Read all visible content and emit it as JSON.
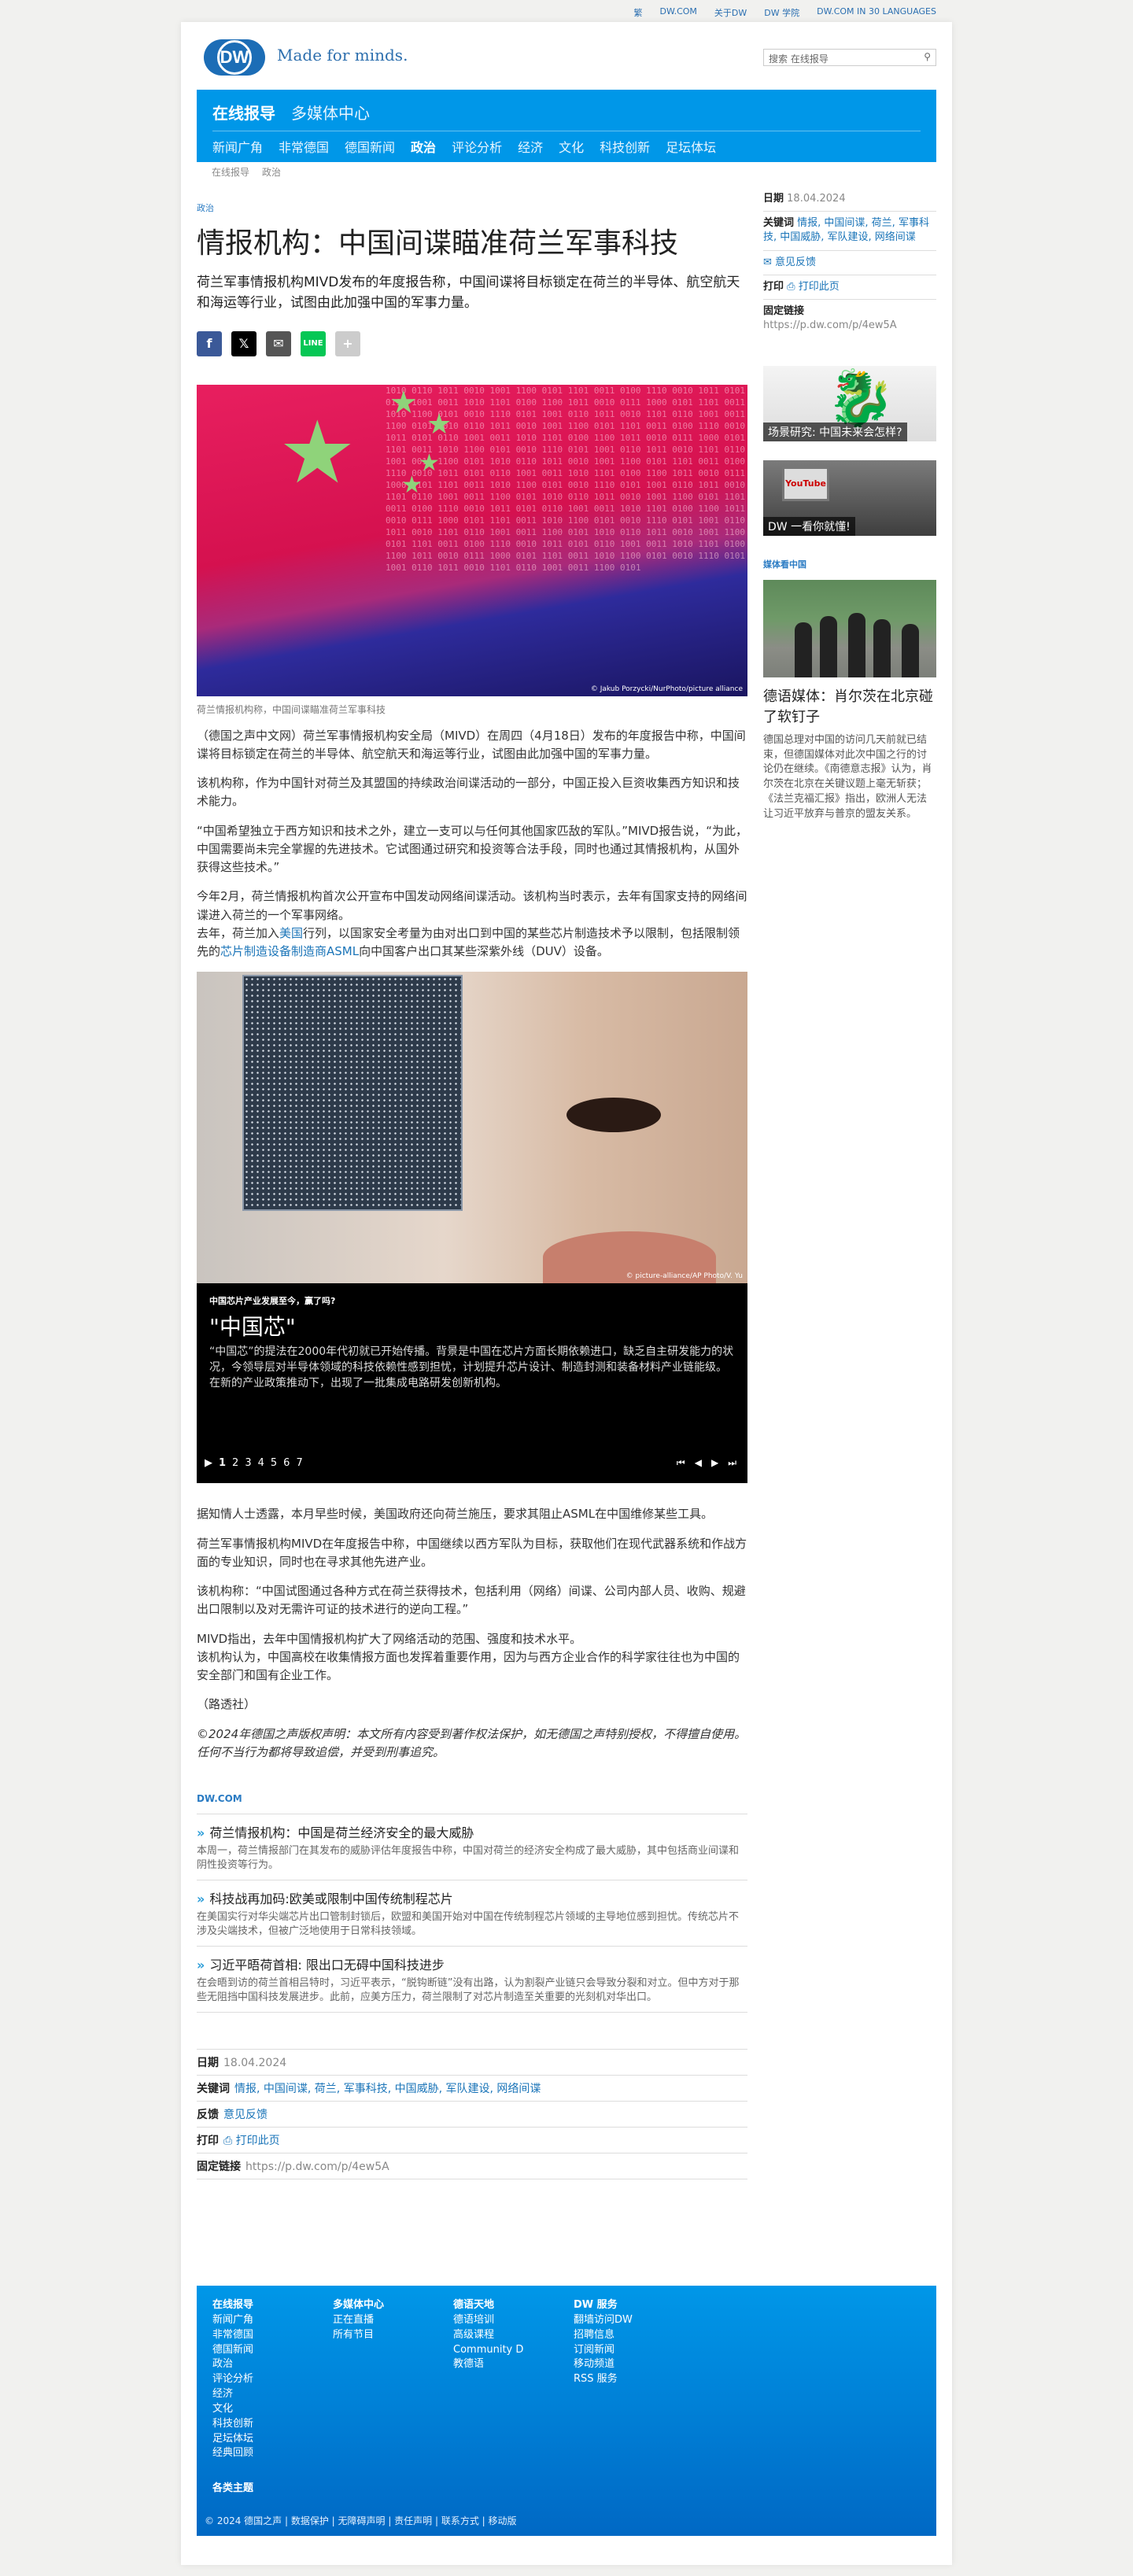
{
  "toplinks": [
    "繁",
    "DW.COM",
    "关于DW",
    "DW 学院",
    "DW.COM IN 30 LANGUAGES"
  ],
  "header": {
    "logo": "DW",
    "tagline": "Made for minds.",
    "search_placeholder": "搜索 在线报导"
  },
  "nav": {
    "tabs": [
      "在线报导",
      "多媒体中心"
    ],
    "sub": [
      "新闻广角",
      "非常德国",
      "德国新闻",
      "政治",
      "评论分析",
      "经济",
      "文化",
      "科技创新",
      "足坛体坛"
    ]
  },
  "breadcrumb": [
    "在线报导",
    "政治"
  ],
  "article": {
    "kicker": "政治",
    "title": "情报机构：中国间谍瞄准荷兰军事科技",
    "lead": "荷兰军事情报机构MIVD发布的年度报告称，中国间谍将目标锁定在荷兰的半导体、航空航天和海运等行业，试图由此加强中国的军事力量。",
    "image_credit": "© Jakub Porzycki/NurPhoto/picture alliance",
    "image_caption": "荷兰情报机构称，中国间谍瞄准荷兰军事科技",
    "p1": "（德国之声中文网）荷兰军事情报机构安全局（MIVD）在周四（4月18日）发布的年度报告中称，中国间谍将目标锁定在荷兰的半导体、航空航天和海运等行业，试图由此加强中国的军事力量。",
    "p2": "该机构称，作为中国针对荷兰及其盟国的持续政治间谍活动的一部分，中国正投入巨资收集西方知识和技术能力。",
    "p3": "“中国希望独立于西方知识和技术之外，建立一支可以与任何其他国家匹敌的军队。”MIVD报告说，“为此，中国需要尚未完全掌握的先进技术。它试图通过研究和投资等合法手段，同时也通过其情报机构，从国外获得这些技术。”",
    "p4": "今年2月，荷兰情报机构首次公开宣布中国发动网络间谍活动。该机构当时表示，去年有国家支持的网络间谍进入荷兰的一个军事网络。",
    "p5a": "去年，荷兰加入",
    "p5link1": "美国",
    "p5b": "行列，以国家安全考量为由对出口到中国的某些芯片制造技术予以限制，包括限制领先的",
    "p5link2": "芯片制造设备制造商ASML",
    "p5c": "向中国客户出口其某些深紫外线（DUV）设备。",
    "gallery_credit": "© picture-alliance/AP Photo/V. Yu",
    "gallery_kicker": "中国芯片产业发展至今，赢了吗?",
    "gallery_title": "\"中国芯\"",
    "gallery_desc": "“中国芯”的提法在2000年代初就已开始传播。背景是中国在芯片方面长期依赖进口，缺乏自主研发能力的状况，今领导层对半导体领域的科技依赖性感到担忧，计划提升芯片设计、制造封测和装备材料产业链能级。在新的产业政策推动下，出现了一批集成电路研发创新机构。",
    "gallery_pages": [
      "1",
      "2",
      "3",
      "4",
      "5",
      "6",
      "7"
    ],
    "p6": "据知情人士透露，本月早些时候，美国政府还向荷兰施压，要求其阻止ASML在中国维修某些工具。",
    "p7": "荷兰军事情报机构MIVD在年度报告中称，中国继续以西方军队为目标，获取他们在现代武器系统和作战方面的专业知识，同时也在寻求其他先进产业。",
    "p8": "该机构称：“中国试图通过各种方式在荷兰获得技术，包括利用（网络）间谍、公司内部人员、收购、规避出口限制以及对无需许可证的技术进行的逆向工程。”",
    "p9": "MIVD指出，去年中国情报机构扩大了网络活动的范围、强度和技术水平。",
    "p10": "该机构认为，中国高校在收集情报方面也发挥着重要作用，因为与西方企业合作的科学家往往也为中国的安全部门和国有企业工作。",
    "p11": "（路透社）",
    "copyright": "©2024年德国之声版权声明：本文所有内容受到著作权法保护，如无德国之声特别授权，不得擅自使用。任何不当行为都将导致追偿，并受到刑事追究。"
  },
  "related": {
    "label": "DW.COM",
    "items": [
      {
        "title": "荷兰情报机构：中国是荷兰经济安全的最大威胁",
        "desc": "本周一，荷兰情报部门在其发布的威胁评估年度报告中称，中国对荷兰的经济安全构成了最大威胁，其中包括商业间谍和阴性投资等行为。"
      },
      {
        "title": "科技战再加码:欧美或限制中国传统制程芯片",
        "desc": "在美国实行对华尖端芯片出口管制封锁后，欧盟和美国开始对中国在传统制程芯片领域的主导地位感到担忧。传统芯片不涉及尖端技术，但被广泛地使用于日常科技领域。"
      },
      {
        "title": "习近平晤荷首相: 限出口无碍中国科技进步",
        "desc": "在会晤到访的荷兰首相吕特时，习近平表示，“脱钩断链”没有出路，认为割裂产业链只会导致分裂和对立。但中方对于那些无阻挡中国科技发展进步。此前，应美方压力，荷兰限制了对芯片制造至关重要的光刻机对华出口。"
      }
    ]
  },
  "meta": {
    "date_label": "日期",
    "date": "18.04.2024",
    "keywords_label": "关键词",
    "keywords": "情报, 中国间谍, 荷兰, 军事科技, 中国威胁, 军队建设, 网络间谍",
    "feedback_label": "反馈",
    "feedback": "意见反馈",
    "print_label": "打印",
    "print": "打印此页",
    "permalink_label": "固定链接",
    "permalink": "https://p.dw.com/p/4ew5A"
  },
  "sidebar": {
    "thumb1": "场景研究: 中国未来会怎样?",
    "thumb2": "DW 一看你就懂!",
    "section": "媒体看中国",
    "story_title": "德语媒体：肖尔茨在北京碰了软钉子",
    "story_text": "德国总理对中国的访问几天前就已结束，但德国媒体对此次中国之行的讨论仍在继续。《南德意志报》认为，肖尔茨在北京在关键议题上毫无斩获；《法兰克福汇报》指出，欧洲人无法让习近平放弃与普京的盟友关系。"
  },
  "footer": {
    "cols": [
      {
        "head": "在线报导",
        "items": [
          "新闻广角",
          "非常德国",
          "德国新闻",
          "政治",
          "评论分析",
          "经济",
          "文化",
          "科技创新",
          "足坛体坛",
          "经典回顾"
        ]
      },
      {
        "head": "多媒体中心",
        "items": [
          "正在直播",
          "所有节目"
        ]
      },
      {
        "head": "德语天地",
        "items": [
          "德语培训",
          "高级课程",
          "Community D",
          "教德语"
        ]
      },
      {
        "head": "DW 服务",
        "items": [
          "翻墙访问DW",
          "招聘信息",
          "订阅新闻",
          "移动频道",
          "RSS 服务"
        ]
      }
    ],
    "sub": "各类主题",
    "bottom": "© 2024 德国之声 | 数据保护 | 无障碍声明 | 责任声明 | 联系方式 | 移动版"
  }
}
